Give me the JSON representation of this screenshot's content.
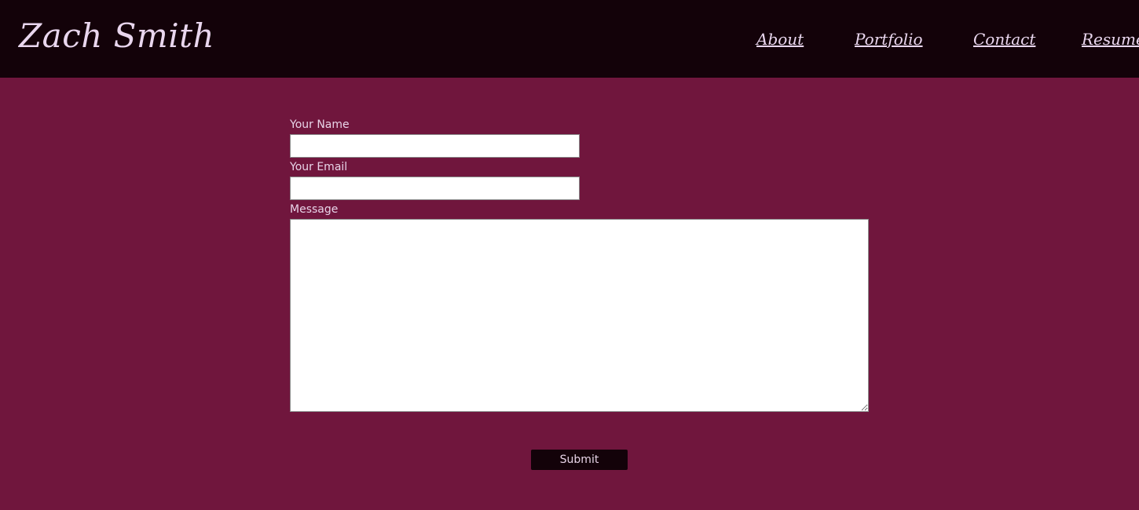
{
  "header": {
    "brand": "Zach Smith",
    "nav": [
      "About",
      "Portfolio",
      "Contact",
      "Resume"
    ]
  },
  "form": {
    "name_label": "Your Name",
    "name_value": "",
    "email_label": "Your Email",
    "email_value": "",
    "message_label": "Message",
    "message_value": "",
    "submit_label": "Submit"
  },
  "colors": {
    "page_background": "#70163d",
    "header_background": "#130209",
    "text": "#e8d4e8",
    "button_background": "#130209"
  }
}
